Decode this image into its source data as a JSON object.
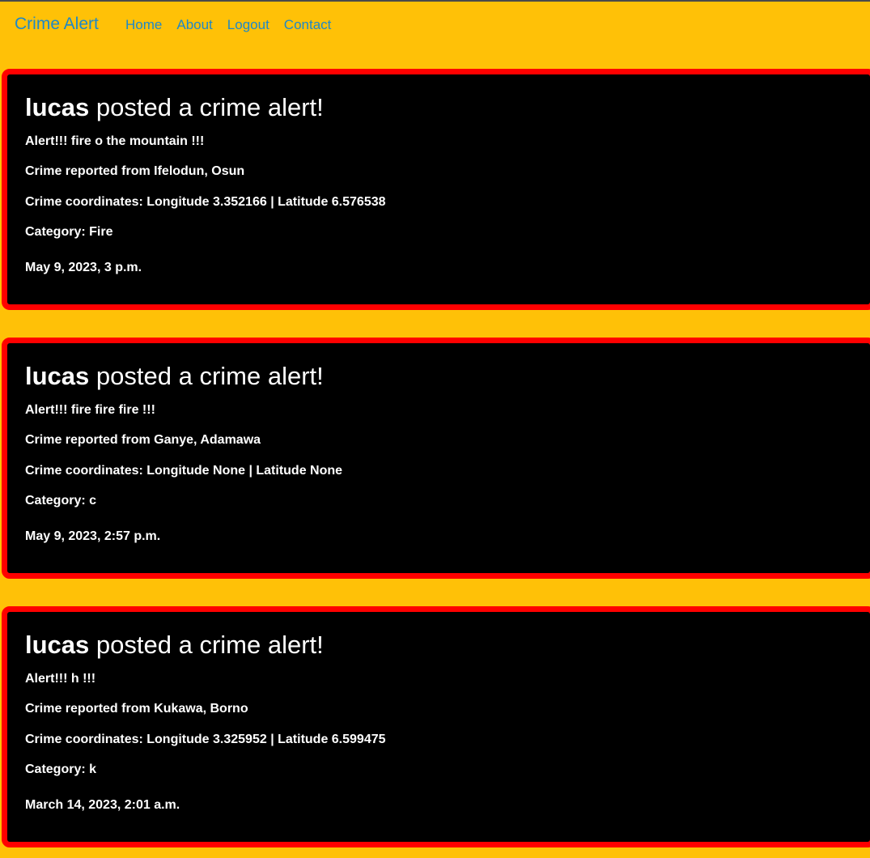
{
  "navbar": {
    "brand": "Crime Alert",
    "links": [
      {
        "label": "Home"
      },
      {
        "label": "About"
      },
      {
        "label": "Logout"
      },
      {
        "label": "Contact"
      }
    ]
  },
  "alerts": [
    {
      "user": "lucas",
      "headline_suffix": "posted a crime alert!",
      "message": "Alert!!! fire o the mountain !!!",
      "location": "Crime reported from Ifelodun, Osun",
      "coordinates": "Crime coordinates: Longitude 3.352166 | Latitude 6.576538",
      "category_label": "Category: ",
      "category_value": "Fire",
      "timestamp": "May 9, 2023, 3 p.m."
    },
    {
      "user": "lucas",
      "headline_suffix": "posted a crime alert!",
      "message": "Alert!!! fire fire fire !!!",
      "location": "Crime reported from Ganye, Adamawa",
      "coordinates": "Crime coordinates: Longitude None | Latitude None",
      "category_label": "Category: ",
      "category_value": "c",
      "timestamp": "May 9, 2023, 2:57 p.m."
    },
    {
      "user": "lucas",
      "headline_suffix": "posted a crime alert!",
      "message": "Alert!!! h !!!",
      "location": "Crime reported from Kukawa, Borno",
      "coordinates": "Crime coordinates: Longitude 3.325952 | Latitude 6.599475",
      "category_label": "Category: ",
      "category_value": "k",
      "timestamp": "March 14, 2023, 2:01 a.m."
    }
  ],
  "colors": {
    "background": "#ffc107",
    "link": "#1e88c8",
    "card_background": "#000000",
    "card_border": "#ff0000",
    "card_text": "#ffffff"
  }
}
